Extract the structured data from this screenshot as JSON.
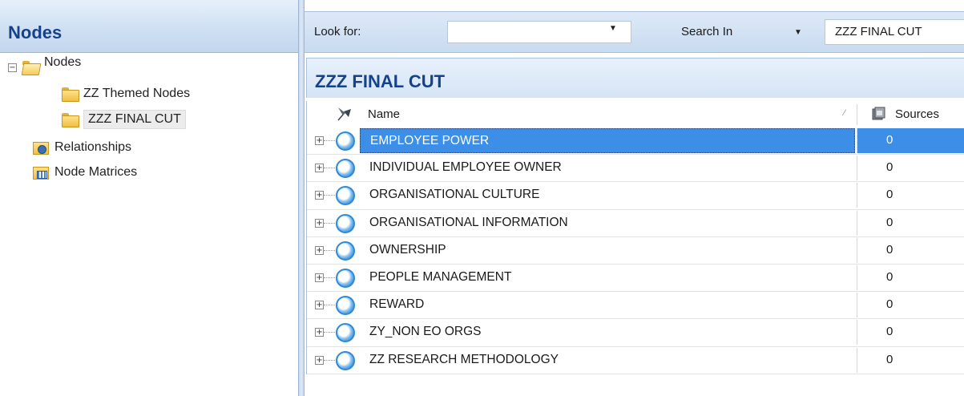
{
  "left_pane": {
    "title": "Nodes",
    "tree": {
      "root": {
        "label": "Nodes",
        "expander": "−"
      },
      "children": [
        {
          "label": "ZZ Themed Nodes"
        },
        {
          "label": "ZZZ FINAL CUT",
          "selected": true
        }
      ],
      "others": [
        {
          "label": "Relationships",
          "icon": "relationships-folder-icon"
        },
        {
          "label": "Node Matrices",
          "icon": "node-matrices-folder-icon"
        }
      ]
    }
  },
  "search_bar": {
    "look_for_label": "Look for:",
    "look_for_value": "",
    "search_in_label": "Search In",
    "search_in_value": "ZZZ FINAL CUT",
    "dropdown_arrow": "▼"
  },
  "list": {
    "title": "ZZZ FINAL CUT",
    "columns": {
      "name": "Name",
      "sources": "Sources",
      "sort_glyph": "⁄"
    },
    "rows": [
      {
        "name": "EMPLOYEE POWER",
        "sources": "0",
        "selected": true
      },
      {
        "name": "INDIVIDUAL EMPLOYEE OWNER",
        "sources": "0"
      },
      {
        "name": "ORGANISATIONAL CULTURE",
        "sources": "0"
      },
      {
        "name": "ORGANISATIONAL INFORMATION",
        "sources": "0"
      },
      {
        "name": "OWNERSHIP",
        "sources": "0"
      },
      {
        "name": "PEOPLE MANAGEMENT",
        "sources": "0"
      },
      {
        "name": "REWARD",
        "sources": "0"
      },
      {
        "name": "ZY_NON EO ORGS",
        "sources": "0"
      },
      {
        "name": "ZZ RESEARCH METHODOLOGY",
        "sources": "0"
      }
    ],
    "row_expander": "+"
  },
  "colors": {
    "header_title": "#15428b",
    "selection": "#3d8ee6",
    "pane_gradient_top": "#e6f0fb",
    "pane_gradient_bottom": "#c2d6ee"
  }
}
